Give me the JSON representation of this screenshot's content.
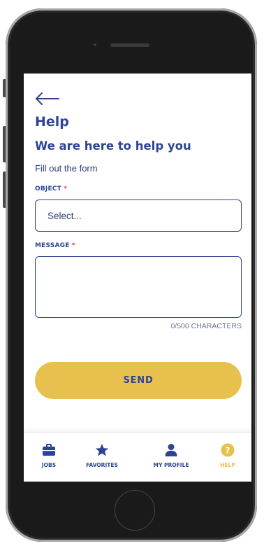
{
  "header": {
    "title": "Help",
    "subtitle": "We are here to help you",
    "intro": "Fill out the form"
  },
  "form": {
    "object_label": "OBJECT",
    "object_required_mark": "*",
    "object_value": "Select...",
    "message_label": "MESSAGE",
    "message_required_mark": "*",
    "message_value": "",
    "char_count": "0/500 CHARACTERS",
    "send_label": "SEND"
  },
  "bottom_nav": {
    "active": "help",
    "items": [
      {
        "id": "jobs",
        "label": "JOBS",
        "icon": "briefcase-icon"
      },
      {
        "id": "favorites",
        "label": "FAVORITES",
        "icon": "star-icon"
      },
      {
        "id": "profile",
        "label": "MY PROFILE",
        "icon": "user-icon"
      },
      {
        "id": "help",
        "label": "HELP",
        "icon": "help-circle-icon"
      }
    ]
  },
  "colors": {
    "primary": "#2c4493",
    "accent": "#e8c04e",
    "required": "#d9403a"
  }
}
